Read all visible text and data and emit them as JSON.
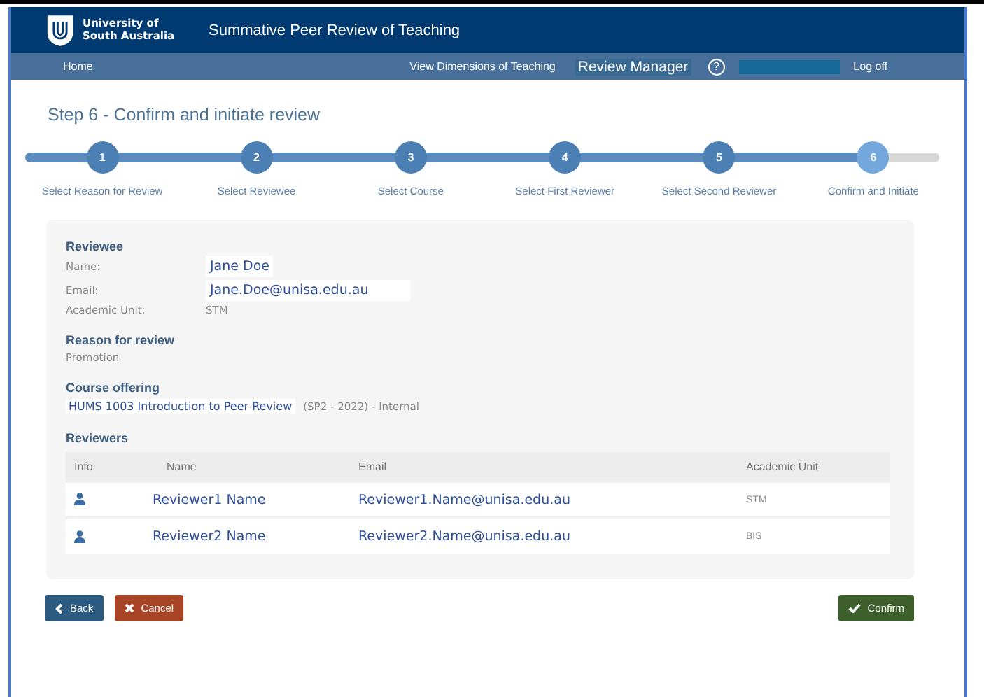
{
  "header": {
    "logo_text": "University of South Australia",
    "title": "Summative Peer Review of Teaching"
  },
  "nav": {
    "home": "Home",
    "links": [
      "View Dimensions of Teaching"
    ],
    "current": "Review Manager",
    "help": "?",
    "logoff": "Log off"
  },
  "page_title": "Step 6 - Confirm and initiate review",
  "steps": [
    {
      "number": "1",
      "label": "Select Reason for Review",
      "selected": false
    },
    {
      "number": "2",
      "label": "Select Reviewee",
      "selected": false
    },
    {
      "number": "3",
      "label": "Select Course",
      "selected": false
    },
    {
      "number": "4",
      "label": "Select First Reviewer",
      "selected": false
    },
    {
      "number": "5",
      "label": "Select Second Reviewer",
      "selected": false
    },
    {
      "number": "6",
      "label": "Confirm and Initiate",
      "selected": true
    }
  ],
  "reviewee": {
    "heading": "Reviewee",
    "fields": [
      {
        "label": "Name:",
        "value": "Jane Doe",
        "kind": "boxed"
      },
      {
        "label": "Email:",
        "value": "Jane.Doe@unisa.edu.au",
        "kind": "boxed"
      },
      {
        "label": "Academic Unit:",
        "value": "STM",
        "kind": "plain"
      }
    ]
  },
  "reason": {
    "heading": "Reason for review",
    "value": "Promotion"
  },
  "course": {
    "heading": "Course offering",
    "name": "HUMS 1003 Introduction to Peer Review",
    "detail": "(SP2 - 2022) - Internal"
  },
  "reviewers": {
    "heading": "Reviewers",
    "columns": [
      "Info",
      "Name",
      "Email",
      "Academic Unit"
    ],
    "rows": [
      {
        "name": "Reviewer1 Name",
        "email": "Reviewer1.Name@unisa.edu.au",
        "unit": "STM"
      },
      {
        "name": "Reviewer2 Name",
        "email": "Reviewer2.Name@unisa.edu.au",
        "unit": "BIS"
      }
    ]
  },
  "buttons": {
    "back": "Back",
    "cancel": "Cancel",
    "confirm": "Confirm"
  }
}
